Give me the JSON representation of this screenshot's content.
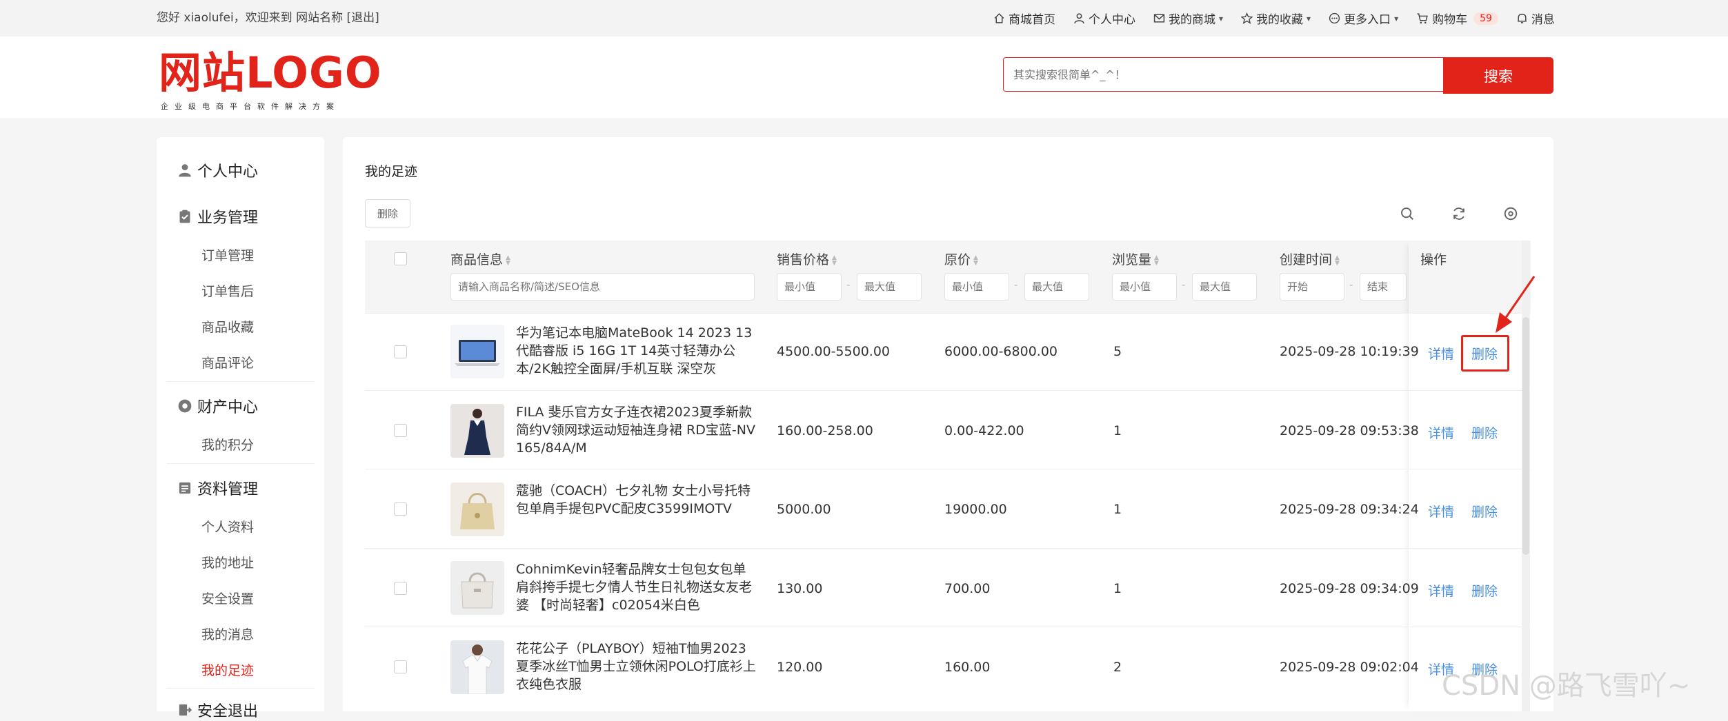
{
  "topbar": {
    "greeting": "您好 xiaolufei，欢迎来到 网站名称 [退出]",
    "nav": [
      {
        "label": "商城首页"
      },
      {
        "label": "个人中心"
      },
      {
        "label": "我的商城"
      },
      {
        "label": "我的收藏"
      },
      {
        "label": "更多入口"
      },
      {
        "label": "购物车"
      },
      {
        "label": "消息"
      }
    ],
    "cart_count": "59"
  },
  "header": {
    "logo_text": "网站LOGO",
    "logo_sub": "企业级电商平台软件解决方案",
    "search_placeholder": "其实搜索很简单^_^！",
    "search_button": "搜索"
  },
  "sidebar": {
    "sections": [
      {
        "title": "个人中心",
        "items": []
      },
      {
        "title": "业务管理",
        "items": [
          "订单管理",
          "订单售后",
          "商品收藏",
          "商品评论"
        ]
      },
      {
        "title": "财产中心",
        "items": [
          "我的积分"
        ]
      },
      {
        "title": "资料管理",
        "items": [
          "个人资料",
          "我的地址",
          "安全设置",
          "我的消息",
          "我的足迹"
        ]
      },
      {
        "title": "安全退出",
        "items": []
      }
    ],
    "active_item": "我的足迹"
  },
  "main": {
    "title": "我的足迹",
    "delete_button": "删除",
    "columns": {
      "goods": "商品信息",
      "price": "销售价格",
      "original": "原价",
      "views": "浏览量",
      "created": "创建时间",
      "actions": "操作"
    },
    "filters": {
      "goods_placeholder": "请输入商品名称/简述/SEO信息",
      "min": "最小值",
      "max": "最大值",
      "start": "开始",
      "end": "结束",
      "dash": "-"
    },
    "rows": [
      {
        "name": "华为笔记本电脑MateBook 14 2023 13代酷睿版 i5 16G 1T 14英寸轻薄办公本/2K触控全面屏/手机互联 深空灰",
        "price": "4500.00-5500.00",
        "original": "6000.00-6800.00",
        "views": "5",
        "created": "2025-09-28 10:19:39"
      },
      {
        "name": "FILA 斐乐官方女子连衣裙2023夏季新款简约V领网球运动短袖连身裙 RD宝蓝-NV 165/84A/M",
        "price": "160.00-258.00",
        "original": "0.00-422.00",
        "views": "1",
        "created": "2025-09-28 09:53:38"
      },
      {
        "name": "蔻驰（COACH）七夕礼物 女士小号托特包单肩手提包PVC配皮C3599IMOTV",
        "price": "5000.00",
        "original": "19000.00",
        "views": "1",
        "created": "2025-09-28 09:34:24"
      },
      {
        "name": "CohnimKevin轻奢品牌女士包包女包单肩斜挎手提七夕情人节生日礼物送女友老婆 【时尚轻奢】c02054米白色",
        "price": "130.00",
        "original": "700.00",
        "views": "1",
        "created": "2025-09-28 09:34:09"
      },
      {
        "name": "花花公子（PLAYBOY）短袖T恤男2023夏季冰丝T恤男士立领休闲POLO打底衫上衣纯色衣服",
        "price": "120.00",
        "original": "160.00",
        "views": "2",
        "created": "2025-09-28 09:02:04"
      }
    ],
    "action_detail": "详情",
    "action_delete": "删除"
  },
  "watermark": "CSDN @路飞雪吖~",
  "colors": {
    "accent": "#e2231a",
    "link": "#4a90e2"
  }
}
